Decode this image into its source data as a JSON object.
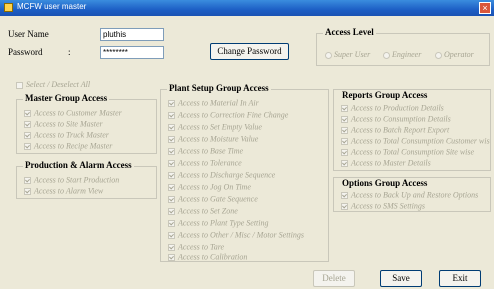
{
  "window": {
    "title": "MCFW user master"
  },
  "login": {
    "username_label": "User Name",
    "username_value": "pluthis",
    "password_label": "Password",
    "password_value": "********",
    "change_password_label": "Change Password"
  },
  "access_level": {
    "title": "Access Level",
    "options": [
      "Super User",
      "Engineer",
      "Operator"
    ]
  },
  "select_deselect_all": "Select / Deselect All",
  "master_group": {
    "title": "Master Group Access",
    "items": [
      "Access to Customer Master",
      "Access to Site Master",
      "Access to Truck Master",
      "Access to Recipe Master"
    ]
  },
  "production_group": {
    "title": "Production & Alarm Access",
    "items": [
      "Access to Start Production",
      "Access to Alarm View"
    ]
  },
  "plant_setup_group": {
    "title": "Plant Setup Group Access",
    "items": [
      "Access to Material In Air",
      "Access to Correction Fine Change",
      "Access to Set Empty Value",
      "Access to Moisture Value",
      "Access to Base Time",
      "Access to Tolerance",
      "Access to Discharge Sequence",
      "Access to Jog On Time",
      "Access to Gate Sequence",
      "Access to Set Zone",
      "Access to Plant Type Setting",
      "Access to Other / Misc / Motor Settings",
      "Access to Tare",
      "Access to Calibration"
    ]
  },
  "reports_group": {
    "title": "Reports Group Access",
    "items": [
      "Access to Production Details",
      "Access to Consumption Details",
      "Access to Batch Report Export",
      "Access to Total Consumption Customer wise",
      "Access to Total Consumption Site wise",
      "Access to Master Details"
    ]
  },
  "options_group": {
    "title": "Options Group Access",
    "items": [
      "Access to Back Up and Restore Options",
      "Access to SMS Settings"
    ]
  },
  "footer": {
    "delete_label": "Delete",
    "save_label": "Save",
    "exit_label": "Exit"
  }
}
